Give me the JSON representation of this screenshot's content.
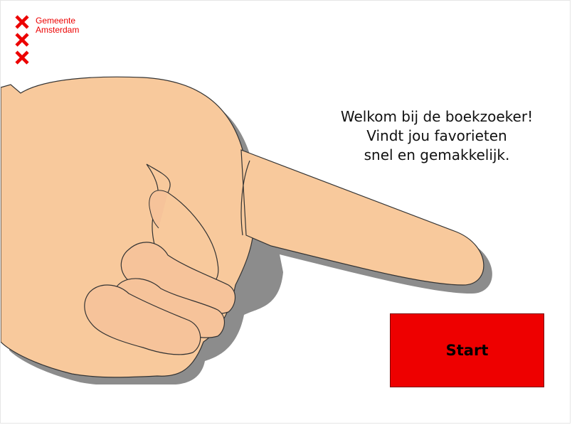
{
  "logo": {
    "line1": "Gemeente",
    "line2": "Amsterdam",
    "icon": "amsterdam-xxx-icon",
    "color": "#ec0000"
  },
  "welcome": {
    "line1": "Welkom bij de boekzoeker!",
    "line2": "Vindt jou favorieten",
    "line3": "snel en gemakkelijk."
  },
  "illustration": {
    "icon": "pointing-hand-icon",
    "skin_color": "#f8c99c"
  },
  "start": {
    "label": "Start",
    "color": "#ee0000"
  }
}
